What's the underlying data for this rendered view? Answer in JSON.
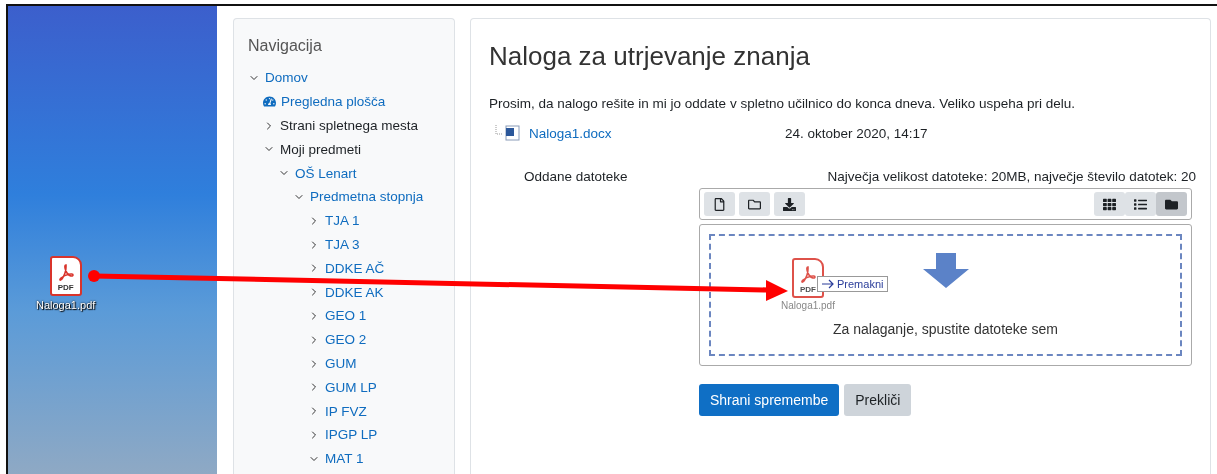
{
  "desktop": {
    "file": {
      "name": "Naloga1.pdf",
      "type_label": "PDF"
    }
  },
  "navigation": {
    "title": "Navigacija",
    "items": [
      {
        "label": "Domov",
        "kind": "node",
        "link": true,
        "expanded": true,
        "children": [
          {
            "label": "Pregledna plošča",
            "kind": "shortcut",
            "link": true
          },
          {
            "label": "Strani spletnega mesta",
            "kind": "node",
            "link": false,
            "expanded": false
          },
          {
            "label": "Moji predmeti",
            "kind": "node",
            "link": false,
            "expanded": true,
            "children": [
              {
                "label": "OŠ Lenart",
                "kind": "node",
                "link": true,
                "expanded": true,
                "children": [
                  {
                    "label": "Predmetna stopnja",
                    "kind": "node",
                    "link": true,
                    "expanded": true,
                    "children": [
                      {
                        "label": "TJA 1",
                        "kind": "node",
                        "link": true,
                        "expanded": false
                      },
                      {
                        "label": "TJA 3",
                        "kind": "node",
                        "link": true,
                        "expanded": false
                      },
                      {
                        "label": "DDKE AČ",
                        "kind": "node",
                        "link": true,
                        "expanded": false
                      },
                      {
                        "label": "DDKE AK",
                        "kind": "node",
                        "link": true,
                        "expanded": false
                      },
                      {
                        "label": "GEO 1",
                        "kind": "node",
                        "link": true,
                        "expanded": false
                      },
                      {
                        "label": "GEO 2",
                        "kind": "node",
                        "link": true,
                        "expanded": false
                      },
                      {
                        "label": "GUM",
                        "kind": "node",
                        "link": true,
                        "expanded": false
                      },
                      {
                        "label": "GUM LP",
                        "kind": "node",
                        "link": true,
                        "expanded": false
                      },
                      {
                        "label": "IP FVZ",
                        "kind": "node",
                        "link": true,
                        "expanded": false
                      },
                      {
                        "label": "IPGP LP",
                        "kind": "node",
                        "link": true,
                        "expanded": false
                      },
                      {
                        "label": "MAT 1",
                        "kind": "node",
                        "link": true,
                        "expanded": true
                      }
                    ]
                  }
                ]
              }
            ]
          }
        ]
      }
    ]
  },
  "main": {
    "title": "Naloga za utrjevanje znanja",
    "description": "Prosim, da nalogo rešite in mi jo oddate v spletno učilnico do konca dneva. Veliko uspeha pri delu.",
    "attachment": {
      "name": "Naloga1.docx",
      "date": "24. oktober 2020, 14:17"
    },
    "submission": {
      "label": "Oddane datoteke",
      "limits": "Največja velikost datoteke: 20MB, največje število datotek: 20",
      "actions": [
        {
          "kind": "file"
        },
        {
          "kind": "folder"
        },
        {
          "kind": "download"
        }
      ],
      "views": [
        {
          "kind": "grid",
          "selected": false
        },
        {
          "kind": "list",
          "selected": false
        },
        {
          "kind": "tree",
          "selected": true
        }
      ],
      "dropzone": {
        "message": "Za nalaganje, spustite datoteke sem",
        "drag": {
          "file": "Naloga1.pdf",
          "type_label": "PDF",
          "tooltip": "Premakni"
        }
      }
    },
    "buttons": [
      {
        "label": "Shrani spremembe",
        "kind": "primary"
      },
      {
        "label": "Prekliči",
        "kind": "secondary"
      }
    ]
  }
}
